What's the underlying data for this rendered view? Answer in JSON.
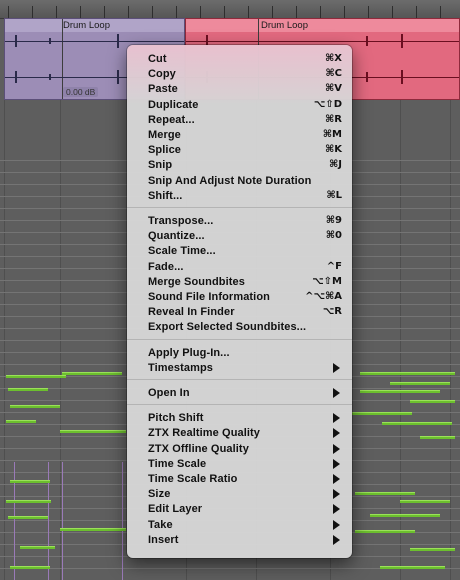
{
  "tracks": {
    "clip_left": {
      "name": "Drum Loop",
      "gain": "0.00 dB"
    },
    "clip_right": {
      "name": "Drum Loop"
    }
  },
  "context_menu": {
    "groups": [
      [
        {
          "label": "Cut",
          "shortcut": "⌘X"
        },
        {
          "label": "Copy",
          "shortcut": "⌘C"
        },
        {
          "label": "Paste",
          "shortcut": "⌘V"
        },
        {
          "label": "Duplicate",
          "shortcut": "⌥⇧D"
        },
        {
          "label": "Repeat...",
          "shortcut": "⌘R"
        },
        {
          "label": "Merge",
          "shortcut": "⌘M"
        },
        {
          "label": "Splice",
          "shortcut": "⌘K"
        },
        {
          "label": "Snip",
          "shortcut": "⌘J"
        },
        {
          "label": "Snip And Adjust Note Duration",
          "shortcut": ""
        },
        {
          "label": "Shift...",
          "shortcut": "⌘L"
        }
      ],
      [
        {
          "label": "Transpose...",
          "shortcut": "⌘9"
        },
        {
          "label": "Quantize...",
          "shortcut": "⌘0"
        },
        {
          "label": "Scale Time...",
          "shortcut": ""
        },
        {
          "label": "Fade...",
          "shortcut": "^F"
        },
        {
          "label": "Merge Soundbites",
          "shortcut": "⌥⇧M"
        },
        {
          "label": "Sound File Information",
          "shortcut": "^⌥⌘A"
        },
        {
          "label": "Reveal In Finder",
          "shortcut": "⌥R"
        },
        {
          "label": "Export Selected Soundbites...",
          "shortcut": ""
        }
      ],
      [
        {
          "label": "Apply Plug-In...",
          "shortcut": ""
        },
        {
          "label": "Timestamps",
          "submenu": true
        }
      ],
      [
        {
          "label": "Open In",
          "submenu": true
        }
      ],
      [
        {
          "label": "Pitch Shift",
          "submenu": true
        },
        {
          "label": "ZTX Realtime Quality",
          "submenu": true
        },
        {
          "label": "ZTX Offline Quality",
          "submenu": true
        },
        {
          "label": "Time Scale",
          "submenu": true
        },
        {
          "label": "Time Scale Ratio",
          "submenu": true
        },
        {
          "label": "Size",
          "submenu": true
        },
        {
          "label": "Edit Layer",
          "submenu": true
        },
        {
          "label": "Take",
          "submenu": true
        },
        {
          "label": "Insert",
          "submenu": true
        }
      ]
    ]
  },
  "icons": {
    "submenu": "triangle-right-icon"
  },
  "colors": {
    "clip_purple": "#9c8db6",
    "clip_red": "#e2697f",
    "midi_note": "#6cbf2e",
    "menu_bg": "#d6d6d6"
  }
}
